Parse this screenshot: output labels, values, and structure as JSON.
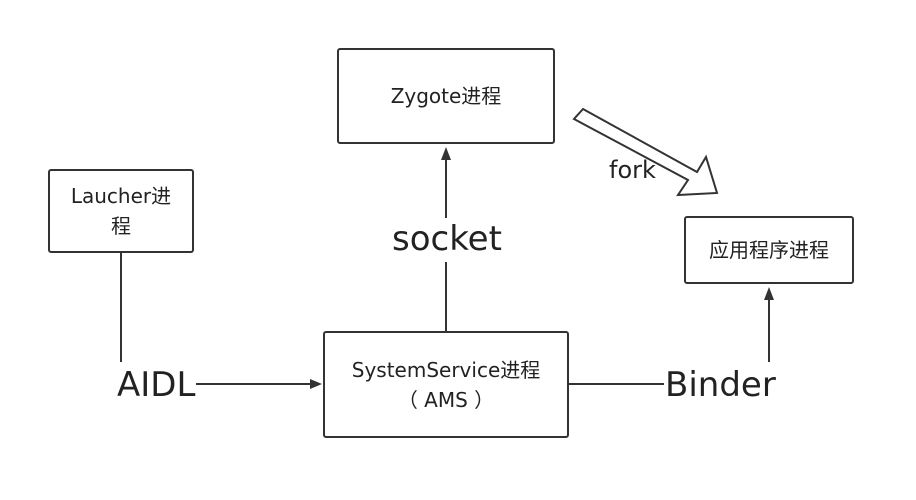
{
  "nodes": {
    "zygote": {
      "label": "Zygote进程"
    },
    "launcher": {
      "line1": "Laucher进",
      "line2": "程"
    },
    "app": {
      "label": "应用程序进程"
    },
    "system_service": {
      "line1": "SystemService进程",
      "line2": "（ AMS ）"
    }
  },
  "edges": {
    "socket": {
      "label": "socket"
    },
    "fork": {
      "label": "fork"
    },
    "aidl": {
      "label": "AIDL"
    },
    "binder": {
      "label": "Binder"
    }
  }
}
